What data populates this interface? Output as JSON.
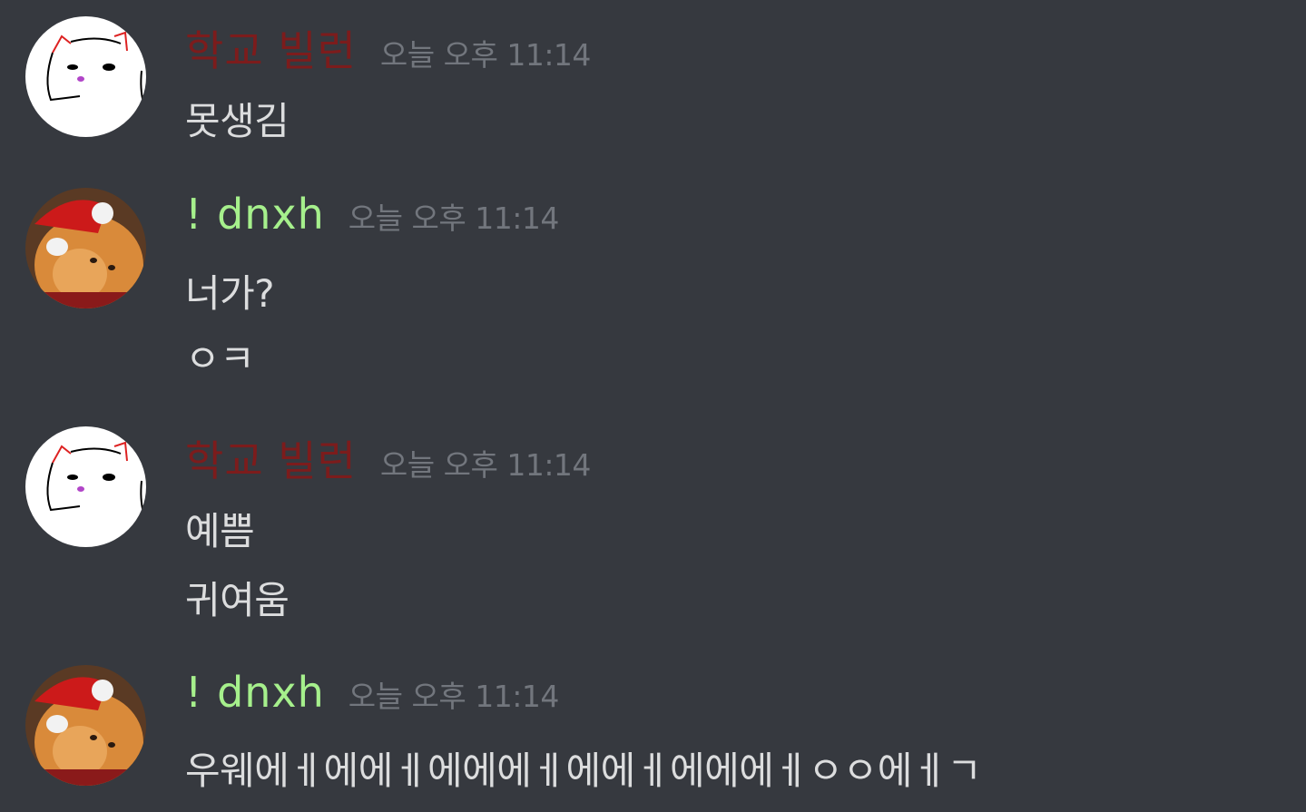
{
  "users": {
    "villain": {
      "name": "학교 빌런",
      "color": "#7c1c1c"
    },
    "dnxh": {
      "name": "! dnxh",
      "color": "#a6f08c"
    }
  },
  "groups": [
    {
      "author": "학교 빌런",
      "timestamp": "오늘 오후 11:14",
      "messages": [
        "못생김"
      ]
    },
    {
      "author": "! dnxh",
      "timestamp": "오늘 오후 11:14",
      "messages": [
        "너가?",
        "ㅇㅋ"
      ]
    },
    {
      "author": "학교 빌런",
      "timestamp": "오늘 오후 11:14",
      "messages": [
        "예쁨",
        "귀여움"
      ]
    },
    {
      "author": "! dnxh",
      "timestamp": "오늘 오후 11:14",
      "messages": [
        "우웨에ㅔ에에ㅔ에에에ㅔ에에ㅔ에에에ㅔㅇㅇ에ㅔㄱ"
      ]
    }
  ]
}
